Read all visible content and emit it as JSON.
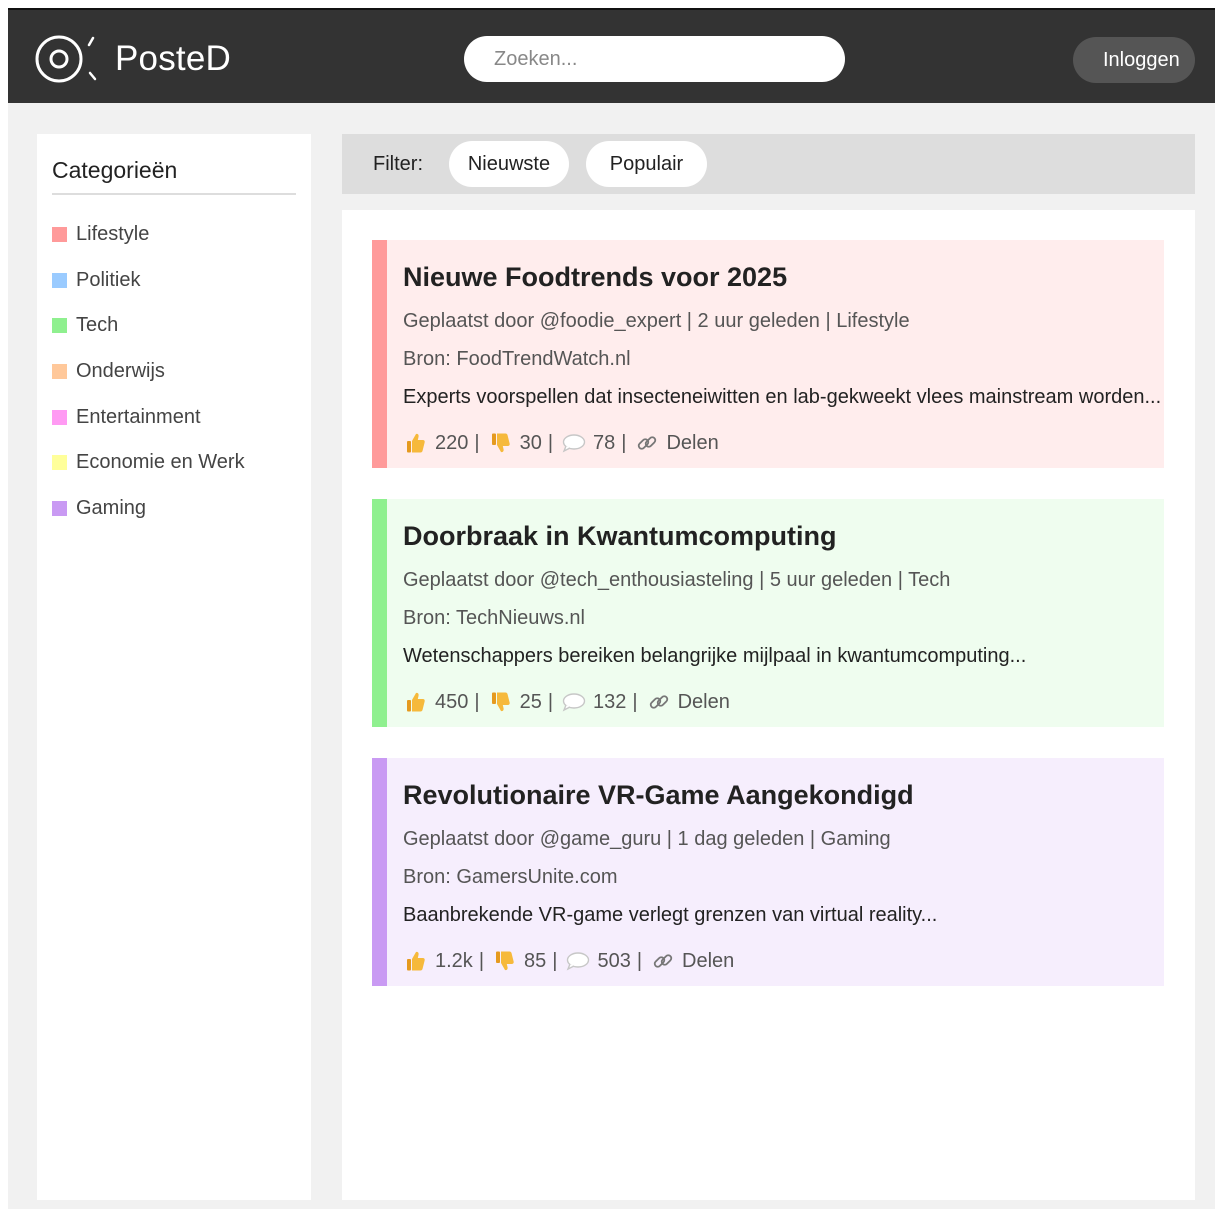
{
  "header": {
    "logo_text": "PosteD",
    "search_placeholder": "Zoeken...",
    "login_label": "Inloggen"
  },
  "sidebar": {
    "title": "Categorieën",
    "items": [
      {
        "label": "Lifestyle",
        "color": "#ff9a9a"
      },
      {
        "label": "Politiek",
        "color": "#9acbff"
      },
      {
        "label": "Tech",
        "color": "#8ff08f"
      },
      {
        "label": "Onderwijs",
        "color": "#ffc89a"
      },
      {
        "label": "Entertainment",
        "color": "#ff9af3"
      },
      {
        "label": "Economie en Werk",
        "color": "#ffff9a"
      },
      {
        "label": "Gaming",
        "color": "#c99af3"
      }
    ]
  },
  "filter": {
    "label": "Filter:",
    "options": [
      "Nieuwste",
      "Populair"
    ]
  },
  "posts": [
    {
      "title": "Nieuwe Foodtrends voor 2025",
      "meta": "Geplaatst door @foodie_expert | 2 uur geleden | Lifestyle",
      "source": "Bron: FoodTrendWatch.nl",
      "excerpt": "Experts voorspellen dat insecteneiwitten en lab-gekweekt vlees mainstream worden...",
      "likes": "220",
      "dislikes": "30",
      "comments": "78",
      "share_label": "Delen",
      "accent": "#ff9a9a",
      "background": "#ffeded"
    },
    {
      "title": "Doorbraak in Kwantumcomputing",
      "meta": "Geplaatst door @tech_enthousiasteling | 5 uur geleden | Tech",
      "source": "Bron: TechNieuws.nl",
      "excerpt": "Wetenschappers bereiken belangrijke mijlpaal in kwantumcomputing...",
      "likes": "450",
      "dislikes": "25",
      "comments": "132",
      "share_label": "Delen",
      "accent": "#8ff08f",
      "background": "#effdef"
    },
    {
      "title": "Revolutionaire VR-Game Aangekondigd",
      "meta": "Geplaatst door @game_guru | 1 dag geleden | Gaming",
      "source": "Bron: GamersUnite.com",
      "excerpt": "Baanbrekende VR-game verlegt grenzen van virtual reality...",
      "likes": "1.2k",
      "dislikes": "85",
      "comments": "503",
      "share_label": "Delen",
      "accent": "#c99af3",
      "background": "#f6eefd"
    }
  ],
  "icons": {
    "logo": "logo-icon",
    "like": "thumbs-up-icon",
    "dislike": "thumbs-down-icon",
    "comment": "comment-bubble-icon",
    "share": "link-icon"
  }
}
